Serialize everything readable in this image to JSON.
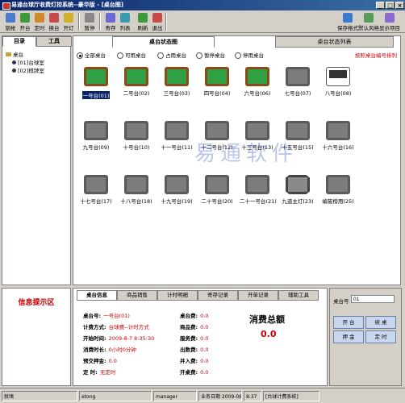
{
  "window": {
    "title": "易通台球厅收费灯控系统--豪华版 - [桌台图]",
    "min": "_",
    "max": "□",
    "close": "×"
  },
  "toolbar": {
    "left": [
      {
        "label": "锁帐",
        "icon": "lock-icon"
      },
      {
        "label": "开台",
        "icon": "open-icon"
      },
      {
        "label": "定时",
        "icon": "clock-icon"
      },
      {
        "label": "换台",
        "icon": "swap-icon"
      },
      {
        "label": "开灯",
        "icon": "lamp-icon"
      },
      {
        "label": "暂停",
        "icon": "pause-icon"
      },
      {
        "label": "寄存",
        "icon": "store-icon"
      },
      {
        "label": "列表",
        "icon": "list-icon"
      },
      {
        "label": "刷新",
        "icon": "refresh-icon"
      },
      {
        "label": "退出",
        "icon": "exit-icon"
      }
    ],
    "right": [
      {
        "label": "保存格式",
        "icon": "save-icon"
      },
      {
        "label": "默认风格",
        "icon": "default-icon"
      },
      {
        "label": "显示项目",
        "icon": "display-icon"
      }
    ]
  },
  "left_tabs": [
    "目录",
    "工具"
  ],
  "tree": {
    "root": "桌台",
    "children": [
      "[01]台球室",
      "[02]棋牌室"
    ]
  },
  "main_tabs": [
    "桌台状态图",
    "桌台状态列表"
  ],
  "filters": {
    "options": [
      "全部桌台",
      "可用桌台",
      "占用桌台",
      "暂停桌台",
      "停用桌台"
    ],
    "selected": 0,
    "hint": "按照桌台编号排列"
  },
  "tables": [
    {
      "name": "一号台(01)",
      "state": "busy",
      "selected": true
    },
    {
      "name": "二号台(02)",
      "state": "busy"
    },
    {
      "name": "三号台(03)",
      "state": "busy"
    },
    {
      "name": "四号台(04)",
      "state": "busy"
    },
    {
      "name": "六号台(06)",
      "state": "busy"
    },
    {
      "name": "七号台(07)",
      "state": "idle"
    },
    {
      "name": "八号台(08)",
      "state": "tv"
    },
    {
      "name": "九号台(09)",
      "state": "idle"
    },
    {
      "name": "十号台(10)",
      "state": "idle"
    },
    {
      "name": "十一号台(11)",
      "state": "idle"
    },
    {
      "name": "十二号台(12)",
      "state": "idle"
    },
    {
      "name": "十三号台(13)",
      "state": "idle"
    },
    {
      "name": "十五号台(15)",
      "state": "idle"
    },
    {
      "name": "十六号台(16)",
      "state": "idle"
    },
    {
      "name": "十七号台(17)",
      "state": "idle"
    },
    {
      "name": "十八号台(18)",
      "state": "idle"
    },
    {
      "name": "十九号台(19)",
      "state": "idle"
    },
    {
      "name": "二十号台(20)",
      "state": "idle"
    },
    {
      "name": "二十一号台(21)",
      "state": "idle"
    },
    {
      "name": "九道主灯(23)",
      "state": "lamp"
    },
    {
      "name": "编筱榜用(25)",
      "state": "idle"
    }
  ],
  "watermark": "易通软件",
  "info": {
    "title": "信息提示区"
  },
  "bottom_tabs": [
    "桌台信息",
    "商品销售",
    "计时明细",
    "寄存记录",
    "开单记录",
    "辅助工具"
  ],
  "detail": {
    "left": [
      {
        "label": "桌台号:",
        "value": "一号台(01)"
      },
      {
        "label": "计费方式:",
        "value": "台球费--计时方式"
      },
      {
        "label": "开始时间:",
        "value": "2009-8-7  8:35:30"
      },
      {
        "label": "消费时长:",
        "value": "0小时0分钟"
      },
      {
        "label": "预交押金:",
        "value": "0.0"
      },
      {
        "label": "定  时:",
        "value": "无定时"
      }
    ],
    "mid": [
      {
        "label": "桌台费:",
        "value": "0.0"
      },
      {
        "label": "商品费:",
        "value": "0.0"
      },
      {
        "label": "服务费:",
        "value": "0.0"
      },
      {
        "label": "出数费:",
        "value": "0.0"
      },
      {
        "label": "并入费:",
        "value": "0.0"
      },
      {
        "label": "开桌费:",
        "value": "0.0"
      }
    ],
    "total_label": "消费总额",
    "total_value": "0.0"
  },
  "right_panel": {
    "table_no_label": "桌台号",
    "table_no_value": "01",
    "buttons": [
      "开  台",
      "续  桌",
      "押  金",
      "定  时"
    ]
  },
  "statusbar": [
    "就绪",
    "etong",
    "manager",
    "业务日期 2009-08-07",
    "8:37",
    "[台球计费系统]"
  ]
}
